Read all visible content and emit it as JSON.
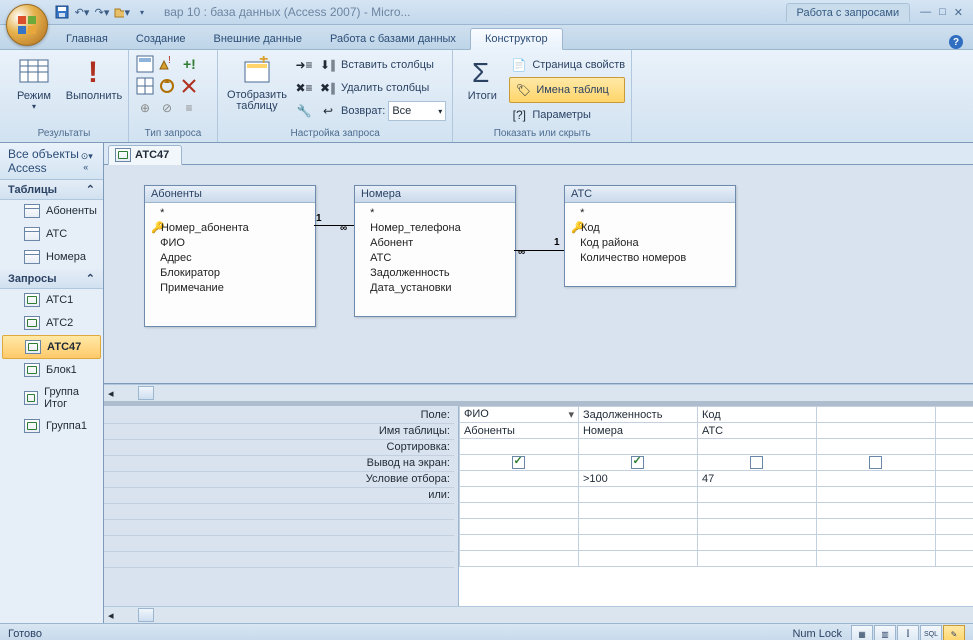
{
  "title": "вар 10 : база данных (Access 2007) - Micro...",
  "context_tab": "Работа с запросами",
  "tabs": {
    "t0": "Главная",
    "t1": "Создание",
    "t2": "Внешние данные",
    "t3": "Работа с базами данных",
    "t4": "Конструктор"
  },
  "ribbon": {
    "g1_title": "Результаты",
    "g1_mode": "Режим",
    "g1_run": "Выполнить",
    "g2_title": "Тип запроса",
    "g3_title": "Настройка запроса",
    "g3_show": "Отобразить таблицу",
    "g3_ins": "Вставить столбцы",
    "g3_del": "Удалить столбцы",
    "g3_ret": "Возврат:",
    "g3_ret_val": "Все",
    "g4_title": "Показать или скрыть",
    "g4_totals": "Итоги",
    "g4_prop": "Страница свойств",
    "g4_names": "Имена таблиц",
    "g4_params": "Параметры"
  },
  "nav": {
    "hdr": "Все объекты Access",
    "sec1": "Таблицы",
    "i1": "Абоненты",
    "i2": "АТС",
    "i3": "Номера",
    "sec2": "Запросы",
    "q1": "АТС1",
    "q2": "АТС2",
    "q3": "АТС47",
    "q4": "Блок1",
    "q5": "Группа Итог",
    "q6": "Группа1"
  },
  "doc_tab": "АТС47",
  "diagram": {
    "t1": {
      "title": "Абоненты",
      "star": "*",
      "f1": "Номер_абонента",
      "f2": "ФИО",
      "f3": "Адрес",
      "f4": "Блокиратор",
      "f5": "Примечание"
    },
    "t2": {
      "title": "Номера",
      "star": "*",
      "f1": "Номер_телефона",
      "f2": "Абонент",
      "f3": "АТС",
      "f4": "Задолженность",
      "f5": "Дата_установки"
    },
    "t3": {
      "title": "АТС",
      "star": "*",
      "f1": "Код",
      "f2": "Код района",
      "f3": "Количество номеров"
    },
    "one": "1",
    "many": "∞"
  },
  "qbe": {
    "r1": "Поле:",
    "r2": "Имя таблицы:",
    "r3": "Сортировка:",
    "r4": "Вывод на экран:",
    "r5": "Условие отбора:",
    "r6": "или:",
    "c1": {
      "field": "ФИО",
      "table": "Абоненты",
      "cond": ""
    },
    "c2": {
      "field": "Задолженность",
      "table": "Номера",
      "cond": ">100"
    },
    "c3": {
      "field": "Код",
      "table": "АТС",
      "cond": "47"
    }
  },
  "status": {
    "ready": "Готово",
    "numlock": "Num Lock",
    "sql": "SQL"
  }
}
